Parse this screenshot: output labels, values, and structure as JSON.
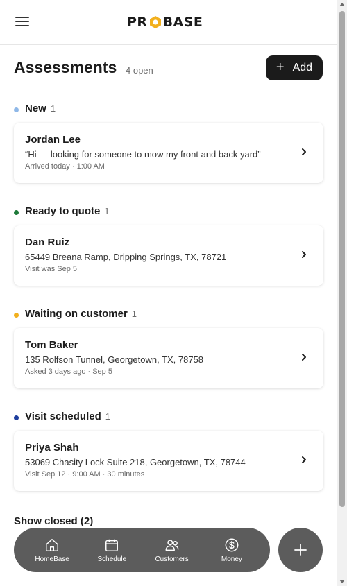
{
  "header": {
    "logo_text_left": "PR",
    "logo_text_right": "BASE",
    "brand_accent": "#f2b01e"
  },
  "page": {
    "title": "Assessments",
    "open_count": "4 open",
    "add_label": "Add"
  },
  "sections": [
    {
      "label": "New",
      "count": "1",
      "dot_color": "#8fb8e8",
      "card": {
        "name": "Jordan Lee",
        "line": "“Hi — looking for someone to mow my front and back yard”",
        "meta": "Arrived today · 1:00 AM"
      }
    },
    {
      "label": "Ready to quote",
      "count": "1",
      "dot_color": "#1e7a3a",
      "card": {
        "name": "Dan Ruiz",
        "line": "65449 Breana Ramp, Dripping Springs, TX, 78721",
        "meta": "Visit was Sep 5"
      }
    },
    {
      "label": "Waiting on customer",
      "count": "1",
      "dot_color": "#f2b01e",
      "card": {
        "name": "Tom Baker",
        "line": "135 Rolfson Tunnel, Georgetown, TX, 78758",
        "meta": "Asked 3 days ago · Sep 5"
      }
    },
    {
      "label": "Visit scheduled",
      "count": "1",
      "dot_color": "#1f3f9e",
      "card": {
        "name": "Priya Shah",
        "line": "53069 Chasity Lock Suite 218, Georgetown, TX, 78744",
        "meta": "Visit Sep 12 · 9:00 AM · 30 minutes"
      }
    }
  ],
  "show_closed": "Show closed (2)",
  "nav": {
    "items": [
      {
        "label": "HomeBase",
        "icon": "home-icon"
      },
      {
        "label": "Schedule",
        "icon": "calendar-icon"
      },
      {
        "label": "Customers",
        "icon": "users-icon"
      },
      {
        "label": "Money",
        "icon": "dollar-icon"
      }
    ],
    "fab_icon": "plus-icon"
  }
}
